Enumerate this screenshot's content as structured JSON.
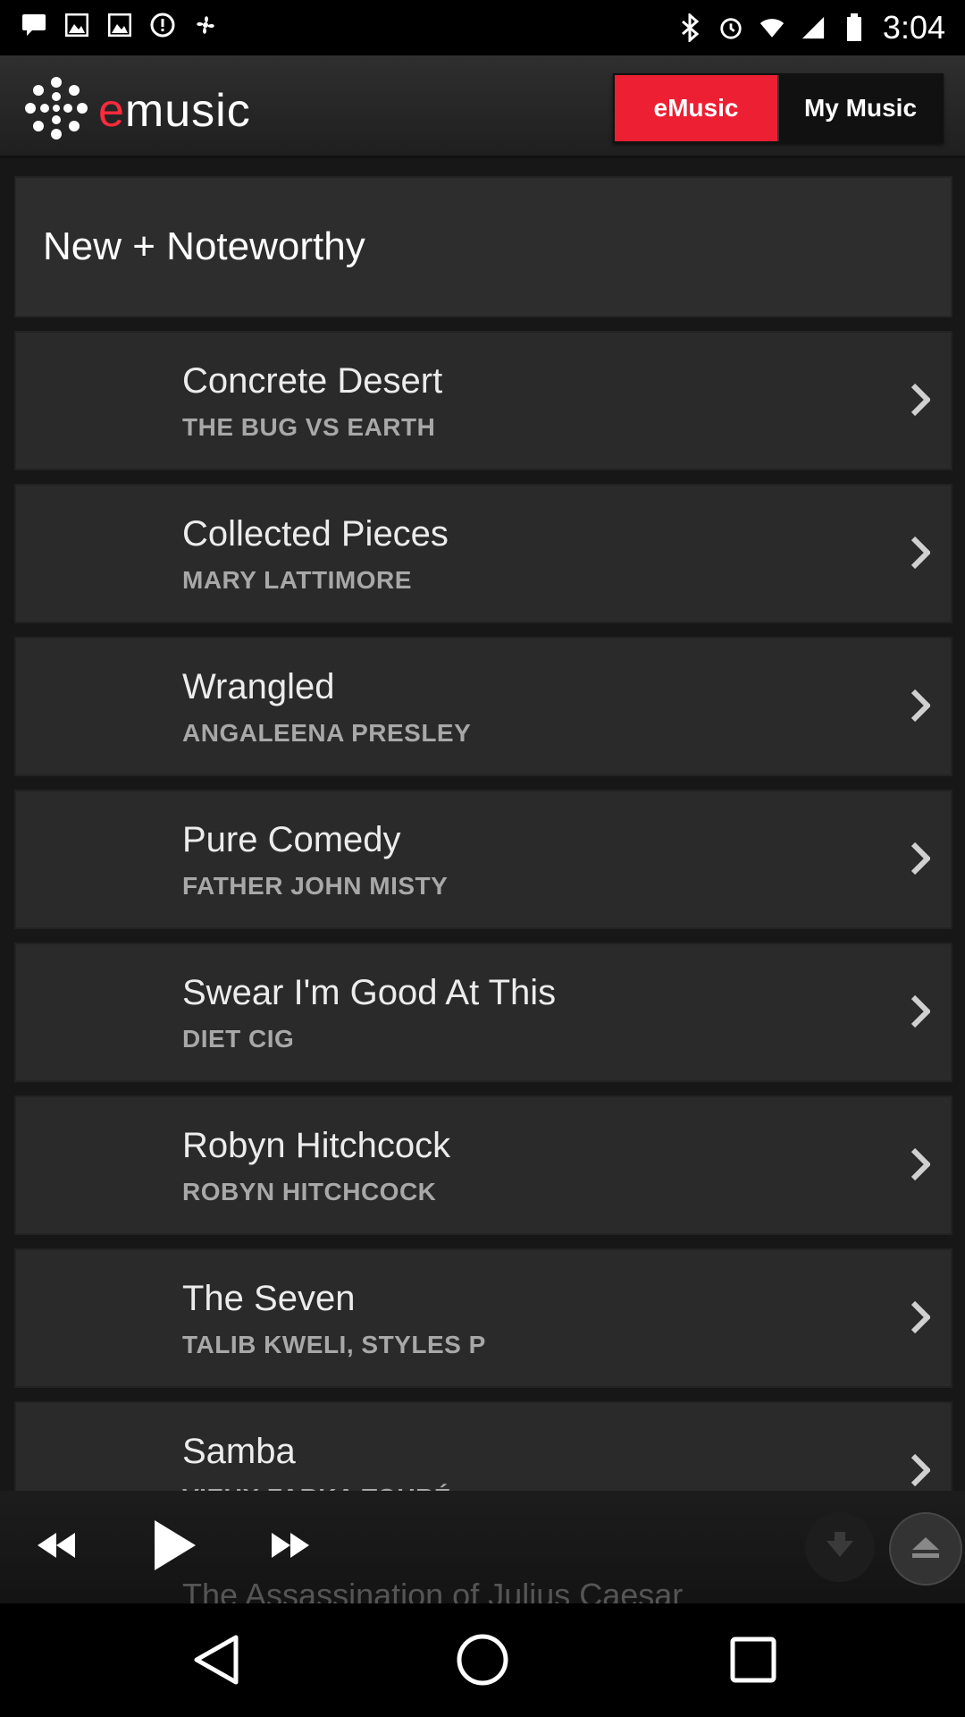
{
  "status_bar": {
    "time": "3:04",
    "left_icons": [
      "message-icon",
      "image-icon",
      "image-icon",
      "alert-icon",
      "fan-icon"
    ],
    "right_icons": [
      "bluetooth-icon",
      "alarm-icon",
      "wifi-icon",
      "signal-icon",
      "battery-icon"
    ]
  },
  "app_bar": {
    "logo_e": "e",
    "logo_rest": "music",
    "tabs": [
      {
        "label": "eMusic",
        "active": true
      },
      {
        "label": "My Music",
        "active": false
      }
    ]
  },
  "section": {
    "title": "New + Noteworthy"
  },
  "albums": [
    {
      "title": "Concrete Desert",
      "artist": "THE BUG VS EARTH"
    },
    {
      "title": "Collected Pieces",
      "artist": "MARY LATTIMORE"
    },
    {
      "title": "Wrangled",
      "artist": "ANGALEENA PRESLEY"
    },
    {
      "title": "Pure Comedy",
      "artist": "FATHER JOHN MISTY"
    },
    {
      "title": "Swear I'm Good At This",
      "artist": "DIET CIG"
    },
    {
      "title": "Robyn Hitchcock",
      "artist": "ROBYN HITCHCOCK"
    },
    {
      "title": "The Seven",
      "artist": "TALIB KWELI, STYLES P"
    },
    {
      "title": "Samba",
      "artist": "VIEUX FARKA TOURÉ"
    }
  ],
  "partial_next_title": "The Assassination of Julius Caesar",
  "player": {
    "controls": [
      "rewind-icon",
      "play-icon",
      "fast-forward-icon",
      "download-icon",
      "eject-icon"
    ]
  },
  "colors": {
    "accent": "#ec1f33",
    "background": "#171717",
    "card": "#2a2a2a"
  }
}
